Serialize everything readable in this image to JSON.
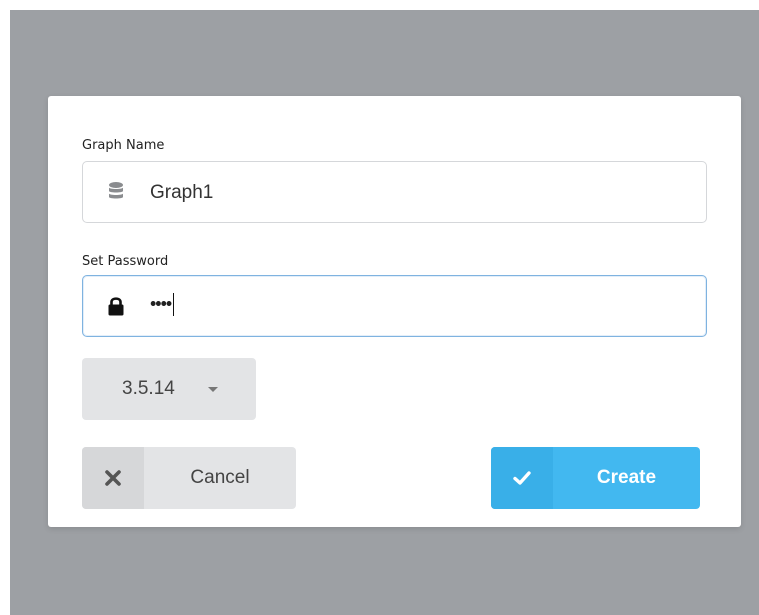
{
  "dialog": {
    "graph_name": {
      "label": "Graph Name",
      "value": "Graph1",
      "icon": "database-icon"
    },
    "password": {
      "label": "Set Password",
      "masked_value": "••••",
      "icon": "lock-icon"
    },
    "version": {
      "selected": "3.5.14",
      "icon": "chevron-down-icon"
    },
    "buttons": {
      "cancel_label": "Cancel",
      "cancel_icon": "close-icon",
      "create_label": "Create",
      "create_icon": "check-icon"
    }
  },
  "colors": {
    "overlay": "#9da0a4",
    "primary": "#42b8f0",
    "secondary": "#e3e4e6",
    "focus_border": "#7fb3e0"
  }
}
